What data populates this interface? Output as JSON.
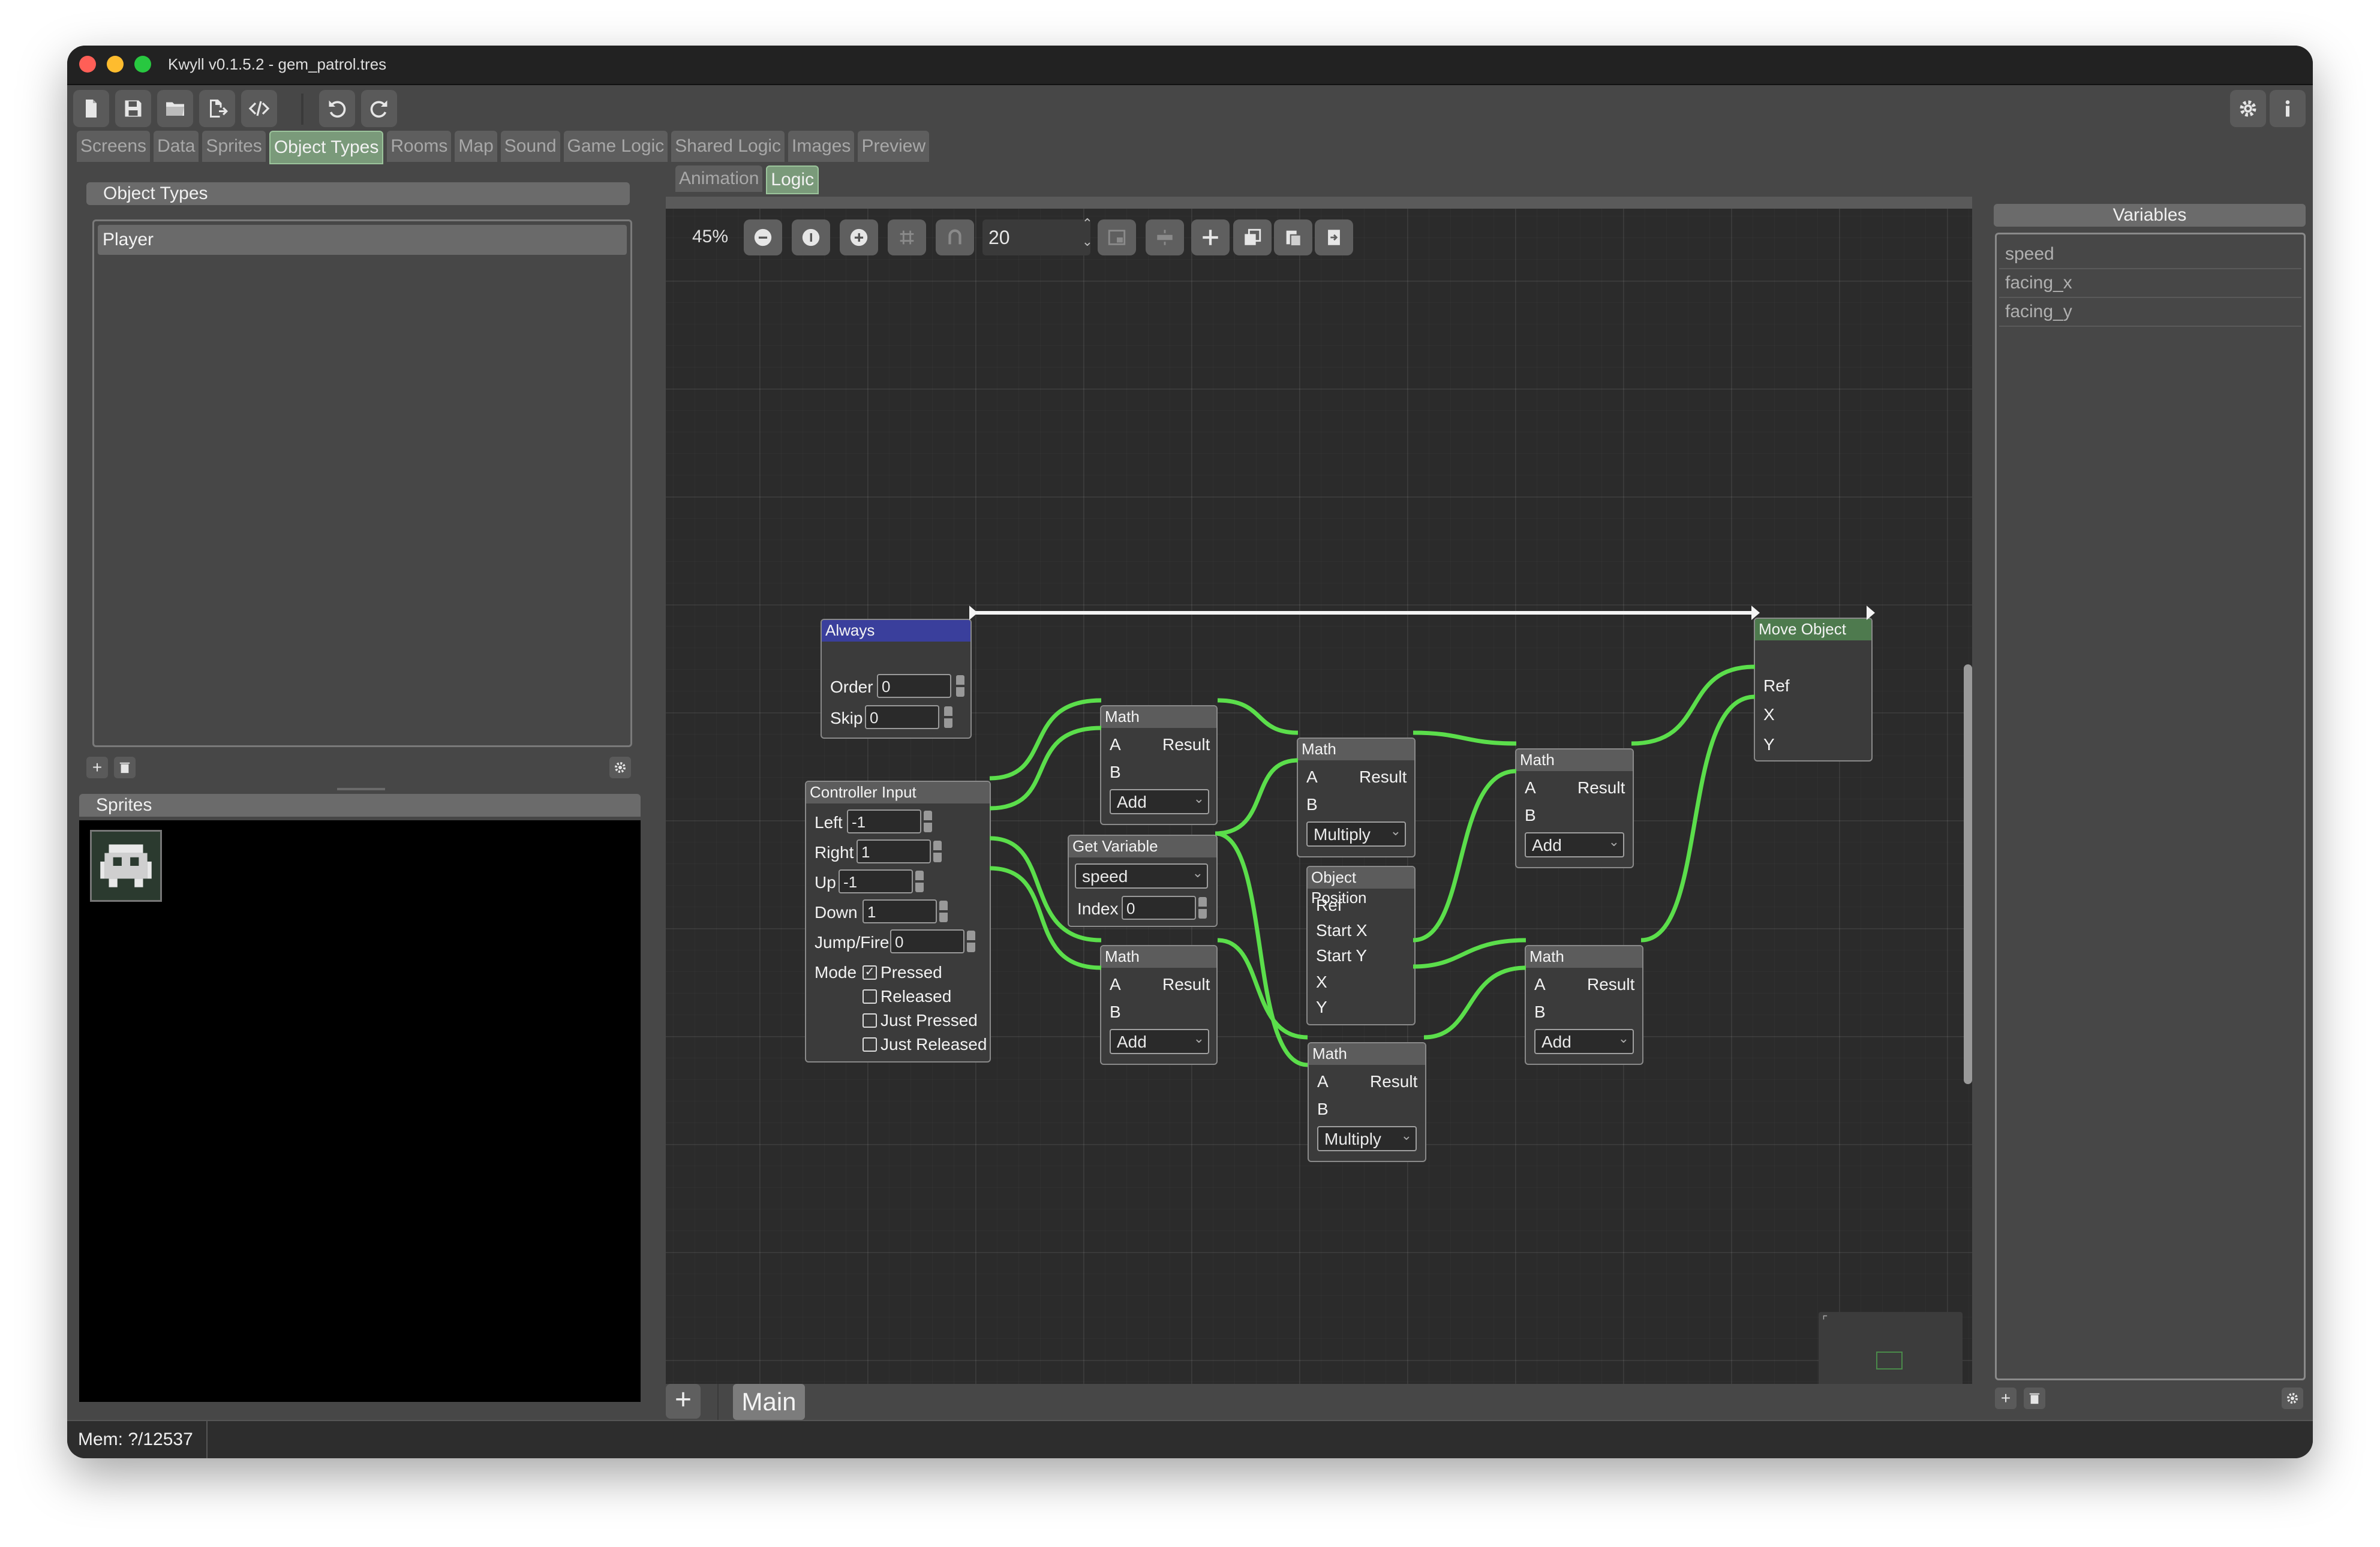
{
  "window": {
    "title": "Kwyll v0.1.5.2 - gem_patrol.tres"
  },
  "toolbar": {
    "buttons": [
      "new-file-icon",
      "save-icon",
      "open-folder-icon",
      "export-icon",
      "code-icon",
      "undo-icon",
      "redo-icon",
      "settings-icon",
      "info-icon"
    ]
  },
  "main_tabs": [
    "Screens",
    "Data",
    "Sprites",
    "Object Types",
    "Rooms",
    "Map",
    "Sound",
    "Game Logic",
    "Shared Logic",
    "Images",
    "Preview"
  ],
  "main_tabs_active": "Object Types",
  "sub_tabs": [
    "Animation",
    "Logic"
  ],
  "sub_tabs_active": "Logic",
  "object_types": {
    "title": "Object Types",
    "items": [
      "Player"
    ]
  },
  "sprites": {
    "title": "Sprites"
  },
  "graph": {
    "zoom": "45%",
    "grid_size": "20",
    "tab_add": "+",
    "tab_label": "Main",
    "nodes": {
      "always": {
        "title": "Always",
        "order_label": "Order",
        "order_value": "0",
        "skip_label": "Skip",
        "skip_value": "0"
      },
      "move_object": {
        "title": "Move Object",
        "ref": "Ref",
        "x": "X",
        "y": "Y"
      },
      "controller_input": {
        "title": "Controller Input",
        "left_label": "Left",
        "left_value": "-1",
        "right_label": "Right",
        "right_value": "1",
        "up_label": "Up",
        "up_value": "-1",
        "down_label": "Down",
        "down_value": "1",
        "jump_label": "Jump/Fire",
        "jump_value": "0",
        "mode_label": "Mode",
        "modes": [
          "Pressed",
          "Released",
          "Just Pressed",
          "Just Released"
        ],
        "mode_checked": "Pressed"
      },
      "math1": {
        "title": "Math",
        "a": "A",
        "b": "B",
        "result": "Result",
        "op": "Add"
      },
      "math2": {
        "title": "Math",
        "a": "A",
        "b": "B",
        "result": "Result",
        "op": "Add"
      },
      "math3": {
        "title": "Math",
        "a": "A",
        "b": "B",
        "result": "Result",
        "op": "Multiply"
      },
      "math4": {
        "title": "Math",
        "a": "A",
        "b": "B",
        "result": "Result",
        "op": "Multiply"
      },
      "math5": {
        "title": "Math",
        "a": "A",
        "b": "B",
        "result": "Result",
        "op": "Add"
      },
      "math6": {
        "title": "Math",
        "a": "A",
        "b": "B",
        "result": "Result",
        "op": "Add"
      },
      "get_variable": {
        "title": "Get Variable",
        "variable": "speed",
        "index_label": "Index",
        "index_value": "0"
      },
      "object_position": {
        "title": "Object Position",
        "ref": "Ref",
        "start_x": "Start X",
        "start_y": "Start Y",
        "x": "X",
        "y": "Y"
      }
    }
  },
  "variables": {
    "title": "Variables",
    "items": [
      "speed",
      "facing_x",
      "facing_y"
    ]
  },
  "status": {
    "mem": "Mem: ?/12537"
  },
  "colors": {
    "wire": "#5bde4b",
    "accent_tab": "#7a9a7a"
  }
}
